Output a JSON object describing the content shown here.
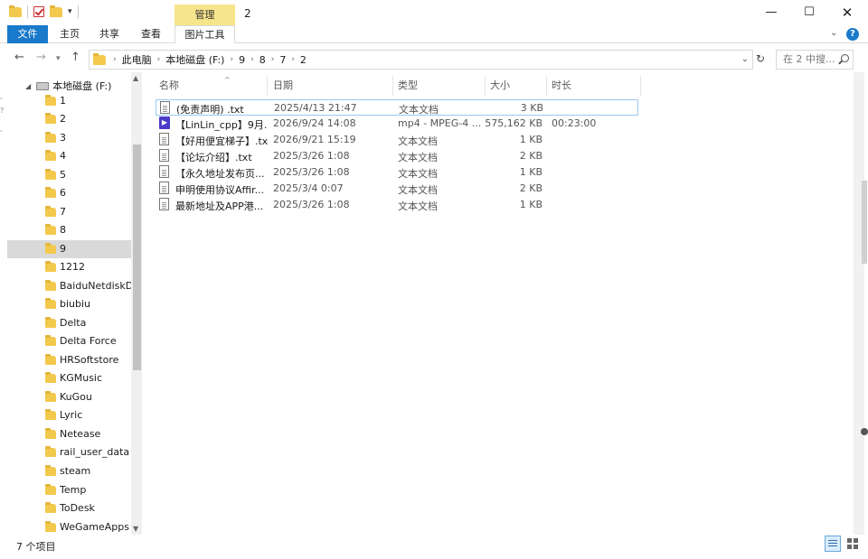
{
  "window": {
    "title": "2",
    "manage_tab": "管理",
    "minimize": "—",
    "maximize": "☐",
    "close": "✕"
  },
  "ribbon": {
    "tabs": [
      "文件",
      "主页",
      "共享",
      "查看",
      "图片工具"
    ]
  },
  "address": {
    "crumbs": [
      "此电脑",
      "本地磁盘 (F:)",
      "9",
      "8",
      "7",
      "2"
    ],
    "search_placeholder": "在 2 中搜..."
  },
  "sidebar": {
    "root": "本地磁盘 (F:)",
    "items": [
      "1",
      "2",
      "3",
      "4",
      "5",
      "6",
      "7",
      "8",
      "9",
      "1212",
      "BaiduNetdiskDo",
      "biubiu",
      "Delta",
      "Delta Force",
      "HRSoftstore",
      "KGMusic",
      "KuGou",
      "Lyric",
      "Netease",
      "rail_user_data",
      "steam",
      "Temp",
      "ToDesk",
      "WeGameApps"
    ],
    "selected_index": 8
  },
  "columns": {
    "name": "名称",
    "date": "日期",
    "type": "类型",
    "size": "大小",
    "duration": "时长"
  },
  "files": [
    {
      "name": "(免责声明) .txt",
      "date": "2025/4/13 21:47",
      "type": "文本文档",
      "size": "3 KB",
      "duration": "",
      "icon": "text-file-icon"
    },
    {
      "name": "【LinLin_cpp】9月...",
      "date": "2026/9/24 14:08",
      "type": "mp4 - MPEG-4 ...",
      "size": "575,162 KB",
      "duration": "00:23:00",
      "icon": "video-file-icon"
    },
    {
      "name": "【好用便宜梯子】.txt",
      "date": "2026/9/21 15:19",
      "type": "文本文档",
      "size": "1 KB",
      "duration": "",
      "icon": "text-file-icon"
    },
    {
      "name": "【论坛介绍】.txt",
      "date": "2025/3/26 1:08",
      "type": "文本文档",
      "size": "2 KB",
      "duration": "",
      "icon": "text-file-icon"
    },
    {
      "name": "【永久地址发布页...",
      "date": "2025/3/26 1:08",
      "type": "文本文档",
      "size": "1 KB",
      "duration": "",
      "icon": "text-file-icon"
    },
    {
      "name": "申明使用协议Affir...",
      "date": "2025/3/4 0:07",
      "type": "文本文档",
      "size": "2 KB",
      "duration": "",
      "icon": "text-file-icon"
    },
    {
      "name": "最新地址及APP港...",
      "date": "2025/3/26 1:08",
      "type": "文本文档",
      "size": "1 KB",
      "duration": "",
      "icon": "text-file-icon"
    }
  ],
  "status": {
    "count": "7 个项目"
  }
}
